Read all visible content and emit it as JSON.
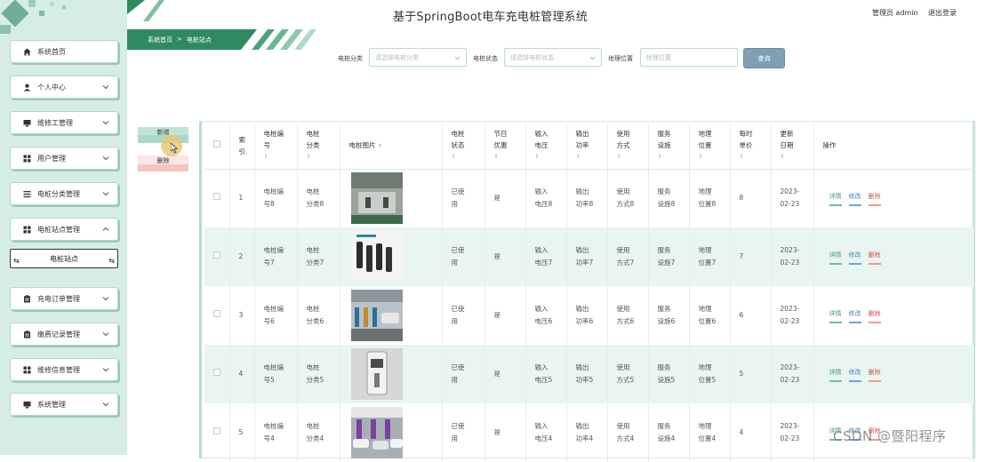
{
  "header": {
    "title": "基于SpringBoot电车充电桩管理系统",
    "user": "管理员 admin",
    "logout": "退出登录"
  },
  "sidebar": {
    "items": [
      {
        "label": "系统首页",
        "icon": "home-icon",
        "expandable": false
      },
      {
        "label": "个人中心",
        "icon": "user-icon",
        "expandable": true
      },
      {
        "label": "维修工管理",
        "icon": "monitor-icon",
        "expandable": true
      },
      {
        "label": "用户管理",
        "icon": "grid-icon",
        "expandable": true
      },
      {
        "label": "电桩分类管理",
        "icon": "list-icon",
        "expandable": true
      },
      {
        "label": "电桩站点管理",
        "icon": "grid-icon",
        "expandable": true,
        "expanded": true
      },
      {
        "label": "充电订单管理",
        "icon": "clipboard-icon",
        "expandable": true
      },
      {
        "label": "缴费记录管理",
        "icon": "clipboard-icon",
        "expandable": true
      },
      {
        "label": "维修信息管理",
        "icon": "grid-icon",
        "expandable": true
      },
      {
        "label": "系统管理",
        "icon": "monitor-icon",
        "expandable": true
      }
    ],
    "sub_item": "电桩站点"
  },
  "breadcrumb": {
    "home": "系统首页",
    "separator": ">",
    "current": "电桩站点"
  },
  "search": {
    "category_label": "电桩分类",
    "category_placeholder": "请选择电桩分类",
    "status_label": "电桩状态",
    "status_placeholder": "请选择电桩状态",
    "location_label": "地理位置",
    "location_placeholder": "地理位置",
    "search_button": "查询"
  },
  "actions": {
    "add": "新增",
    "delete": "删除"
  },
  "table": {
    "headers": {
      "index": "索\n引.",
      "code": "电桩编\n号",
      "category": "电桩\n分类",
      "image": "电桩图片",
      "status": "电桩\n状态",
      "holiday": "节日\n优惠",
      "voltage": "输入\n电压",
      "power": "输出\n功率",
      "usage": "使用\n方式",
      "service": "服务\n设施",
      "location": "地理\n位置",
      "price": "每时\n单价",
      "date": "更新\n日期",
      "ops": "操作"
    },
    "op_labels": {
      "detail": "详情",
      "edit": "修改",
      "delete": "删除"
    },
    "rows": [
      {
        "index": "1",
        "code": "电桩编\n号8",
        "category": "电桩\n分类8",
        "image": "charger-photo-8",
        "status": "已使\n用",
        "holiday": "是",
        "voltage": "输入\n电压8",
        "power": "输出\n功率8",
        "usage": "使用\n方式8",
        "service": "服务\n设施8",
        "location": "地理\n位置8",
        "price": "8",
        "date": "2023-\n02-23"
      },
      {
        "index": "2",
        "code": "电桩编\n号7",
        "category": "电桩\n分类7",
        "image": "charger-photo-7",
        "status": "已使\n用",
        "holiday": "是",
        "voltage": "输入\n电压7",
        "power": "输出\n功率7",
        "usage": "使用\n方式7",
        "service": "服务\n设施7",
        "location": "地理\n位置7",
        "price": "7",
        "date": "2023-\n02-23"
      },
      {
        "index": "3",
        "code": "电桩编\n号6",
        "category": "电桩\n分类6",
        "image": "charger-photo-6",
        "status": "已使\n用",
        "holiday": "是",
        "voltage": "输入\n电压6",
        "power": "输出\n功率6",
        "usage": "使用\n方式6",
        "service": "服务\n设施6",
        "location": "地理\n位置6",
        "price": "6",
        "date": "2023-\n02-23"
      },
      {
        "index": "4",
        "code": "电桩编\n号5",
        "category": "电桩\n分类5",
        "image": "charger-photo-5",
        "status": "已使\n用",
        "holiday": "是",
        "voltage": "输入\n电压5",
        "power": "输出\n功率5",
        "usage": "使用\n方式5",
        "service": "服务\n设施5",
        "location": "地理\n位置5",
        "price": "5",
        "date": "2023-\n02-23"
      },
      {
        "index": "5",
        "code": "电桩编\n号4",
        "category": "电桩\n分类4",
        "image": "charger-photo-4",
        "status": "已使\n用",
        "holiday": "是",
        "voltage": "输入\n电压4",
        "power": "输出\n功率4",
        "usage": "使用\n方式4",
        "service": "服务\n设施4",
        "location": "地理\n位置4",
        "price": "4",
        "date": "2023-\n02-23"
      }
    ]
  },
  "watermark": "CSDN @暨阳程序",
  "colors": {
    "sidebar_bg": "#d6ede5",
    "accent_green": "#3c9a6a",
    "search_button": "#7f9fb5",
    "delete_red": "#d9534f"
  }
}
